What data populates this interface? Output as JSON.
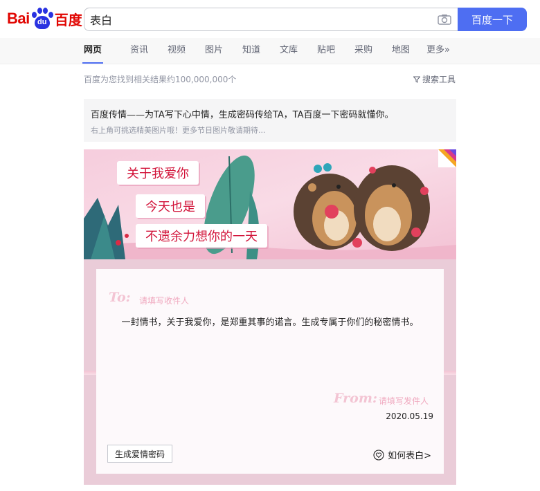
{
  "logo": {
    "bai": "Bai",
    "du": "du",
    "zh": "百度"
  },
  "search": {
    "query": "表白",
    "button_label": "百度一下"
  },
  "tabs": [
    {
      "label": "网页"
    },
    {
      "label": "资讯"
    },
    {
      "label": "视频"
    },
    {
      "label": "图片"
    },
    {
      "label": "知道"
    },
    {
      "label": "文库"
    },
    {
      "label": "贴吧"
    },
    {
      "label": "采购"
    },
    {
      "label": "地图"
    },
    {
      "label": "更多»"
    }
  ],
  "results": {
    "count_text": "百度为您找到相关结果约100,000,000个",
    "tools_label": "搜索工具"
  },
  "card": {
    "title": "百度传情——为TA写下心中情，生成密码传给TA，TA百度一下密码就懂你。",
    "subtitle": "右上角可挑选精美图片哦！更多节日图片敬请期待...",
    "banner_lines": [
      "关于我爱你",
      "今天也是",
      "不遗余力想你的一天"
    ],
    "letter": {
      "to_label": "To:",
      "to_placeholder": "请填写收件人",
      "body": "一封情书，关于我爱你，是郑重其事的诺言。生成专属于你们的秘密情书。",
      "from_label": "From:",
      "from_placeholder": "请填写发件人",
      "date": "2020.05.19"
    },
    "generate_button": "生成爱情密码",
    "how_link": "如何表白>"
  },
  "colors": {
    "brand_blue": "#4e6ef2",
    "brand_red": "#e10602",
    "pink_bg": "#eaccd8"
  }
}
